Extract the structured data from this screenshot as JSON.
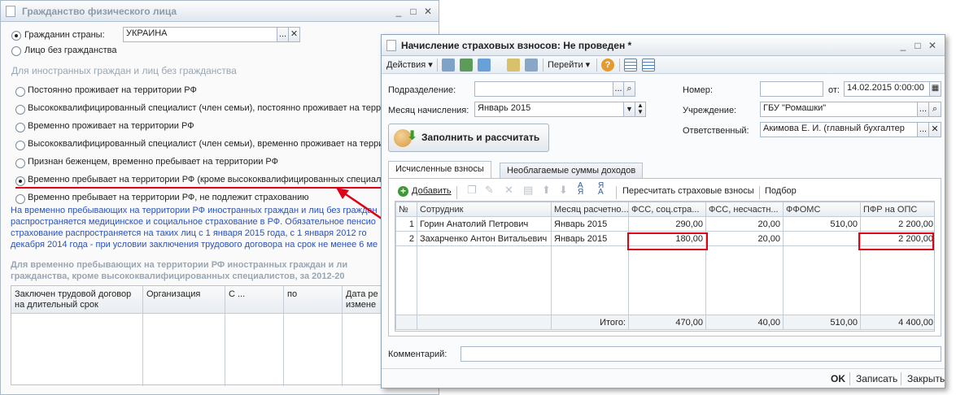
{
  "citizenship_window": {
    "title": "Гражданство физического лица",
    "citizen_label": "Гражданин страны:",
    "country_value": "УКРАИНА",
    "stateless_label": "Лицо без гражданства",
    "foreign_section_header": "Для иностранных граждан и лиц без гражданства",
    "options": [
      "Постоянно проживает на территории РФ",
      "Высококвалифицированный специалист (член семьи), постоянно проживает на террит",
      "Временно проживает на территории РФ",
      "Высококвалифицированный специалист (член семьи), временно проживает на террит",
      "Признан беженцем, временно пребывает на территории РФ",
      "Временно пребывает на территории РФ (кроме высококвалифицированных специали",
      "Временно пребывает на территории РФ, не подлежит страхованию"
    ],
    "note_lines": [
      "На временно пребывающих на территории РФ иностранных граждан и лиц без граждан",
      "распространяется медицинское и социальное страхование в РФ. Обязательное пенсио",
      "страхование распространяется на таких лиц с 1 января 2015 года, с 1 января 2012 го",
      "декабря 2014 года - при условии заключения трудового договора на срок не менее 6 ме"
    ],
    "temp_section_lines": [
      "Для временно пребывающих на территории РФ иностранных граждан и ли",
      "гражданства, кроме высококвалифицированных специалистов, за 2012-20"
    ],
    "table_headers": [
      "Заключен трудовой договор на длительный срок",
      "Организация",
      "С ...",
      "по",
      "Дата ре измене"
    ]
  },
  "insurance_window": {
    "title": "Начисление страховых взносов: Не проведен *",
    "menu": {
      "actions": "Действия",
      "goto": "Перейти"
    },
    "fields": {
      "department_label": "Подразделение:",
      "department_value": "",
      "month_label": "Месяц начисления:",
      "month_value": "Январь 2015",
      "number_label": "Номер:",
      "number_value": "",
      "date_label": "от:",
      "date_value": "14.02.2015 0:00:00",
      "org_label": "Учреждение:",
      "org_value": "ГБУ \"Ромашки\"",
      "resp_label": "Ответственный:",
      "resp_value": "Акимова Е. И. (главный бухгалтер"
    },
    "fill_button": "Заполнить и рассчитать",
    "tabs": [
      "Исчисленные взносы",
      "Необлагаемые суммы доходов"
    ],
    "table_toolbar": {
      "add": "Добавить",
      "recalc": "Пересчитать страховые взносы",
      "select": "Подбор"
    },
    "columns": [
      "№",
      "Сотрудник",
      "Месяц расчетно...",
      "ФСС, соц.стра...",
      "ФСС, несчастн...",
      "ФФОМС",
      "ПФР на ОПС"
    ],
    "rows": [
      {
        "n": "1",
        "employee": "Горин Анатолий Петрович",
        "month": "Январь 2015",
        "fss_soc": "290,00",
        "fss_ns": "20,00",
        "ffoms": "510,00",
        "pfr": "2 200,00"
      },
      {
        "n": "2",
        "employee": "Захарченко Антон Витальевич",
        "month": "Январь 2015",
        "fss_soc": "180,00",
        "fss_ns": "20,00",
        "ffoms": "",
        "pfr": "2 200,00"
      }
    ],
    "totals": {
      "label": "Итого:",
      "fss_soc": "470,00",
      "fss_ns": "40,00",
      "ffoms": "510,00",
      "pfr": "4 400,00"
    },
    "comment_label": "Комментарий:",
    "comment_value": "",
    "footer": {
      "ok": "OK",
      "save": "Записать",
      "close": "Закрыть"
    }
  },
  "colors": {
    "highlight_red": "#e00018",
    "note_blue": "#2a52be"
  }
}
